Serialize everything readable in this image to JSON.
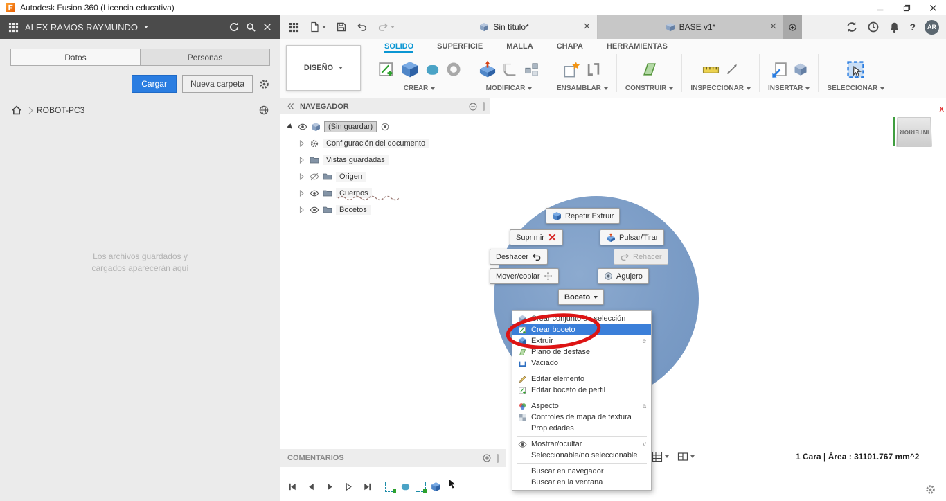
{
  "titlebar": {
    "title": "Autodesk Fusion 360 (Licencia educativa)"
  },
  "data_panel": {
    "user": "ALEX RAMOS RAYMUNDO",
    "tab_datos": "Datos",
    "tab_personas": "Personas",
    "upload": "Cargar",
    "new_folder": "Nueva carpeta",
    "location": "ROBOT-PC3",
    "empty_line1": "Los archivos guardados y",
    "empty_line2": "cargados aparecerán aquí"
  },
  "doc_tabs": {
    "tab1": "Sin título*",
    "tab2": "BASE v1*"
  },
  "account": {
    "initials": "AR"
  },
  "icons": {
    "help": "?"
  },
  "ribbon": {
    "workspace": "DISEÑO",
    "tab_solido": "SOLIDO",
    "tab_superficie": "SUPERFICIE",
    "tab_malla": "MALLA",
    "tab_chapa": "CHAPA",
    "tab_herramientas": "HERRAMIENTAS",
    "group_crear": "CREAR",
    "group_modificar": "MODIFICAR",
    "group_ensamblar": "ENSAMBLAR",
    "group_construir": "CONSTRUIR",
    "group_inspeccionar": "INSPECCIONAR",
    "group_insertar": "INSERTAR",
    "group_seleccionar": "SELECCIONAR"
  },
  "navigator": {
    "title": "NAVEGADOR",
    "root_label": "(Sin guardar)",
    "item_config": "Configuración del documento",
    "item_vistas": "Vistas guardadas",
    "item_origen": "Origen",
    "item_cuerpos": "Cuerpos",
    "item_bocetos": "Bocetos"
  },
  "comments": {
    "title": "COMENTARIOS"
  },
  "marking_menu": {
    "repetir": "Repetir Extruir",
    "suprimir": "Suprimir",
    "pulsar": "Pulsar/Tirar",
    "deshacer": "Deshacer",
    "rehacer": "Rehacer",
    "mover": "Mover/copiar",
    "agujero": "Agujero",
    "boceto": "Boceto"
  },
  "context_menu": {
    "items": [
      {
        "label": "Crear conjunto de selección"
      },
      {
        "label": "Crear boceto"
      },
      {
        "label": "Extruir",
        "shortcut": "e"
      },
      {
        "label": "Plano de desfase"
      },
      {
        "label": "Vaciado"
      },
      {
        "label": "Editar elemento"
      },
      {
        "label": "Editar boceto de perfil"
      },
      {
        "label": "Aspecto",
        "shortcut": "a"
      },
      {
        "label": "Controles de mapa de textura"
      },
      {
        "label": "Propiedades"
      },
      {
        "label": "Mostrar/ocultar",
        "shortcut": "v"
      },
      {
        "label": "Seleccionable/no seleccionable"
      },
      {
        "label": "Buscar en navegador"
      },
      {
        "label": "Buscar en la ventana"
      }
    ]
  },
  "status": {
    "selection": "1 Cara | Área : 31101.767 mm^2"
  },
  "viewcube": {
    "face": "INFERIOR",
    "axis_x": "X"
  },
  "colors": {
    "accent_blue": "#0a96d3",
    "highlight_blue": "#3b7fd9",
    "body_blue": "#7b9cc6",
    "annotation_red": "#dd1414",
    "upload_blue": "#2a7de1"
  }
}
